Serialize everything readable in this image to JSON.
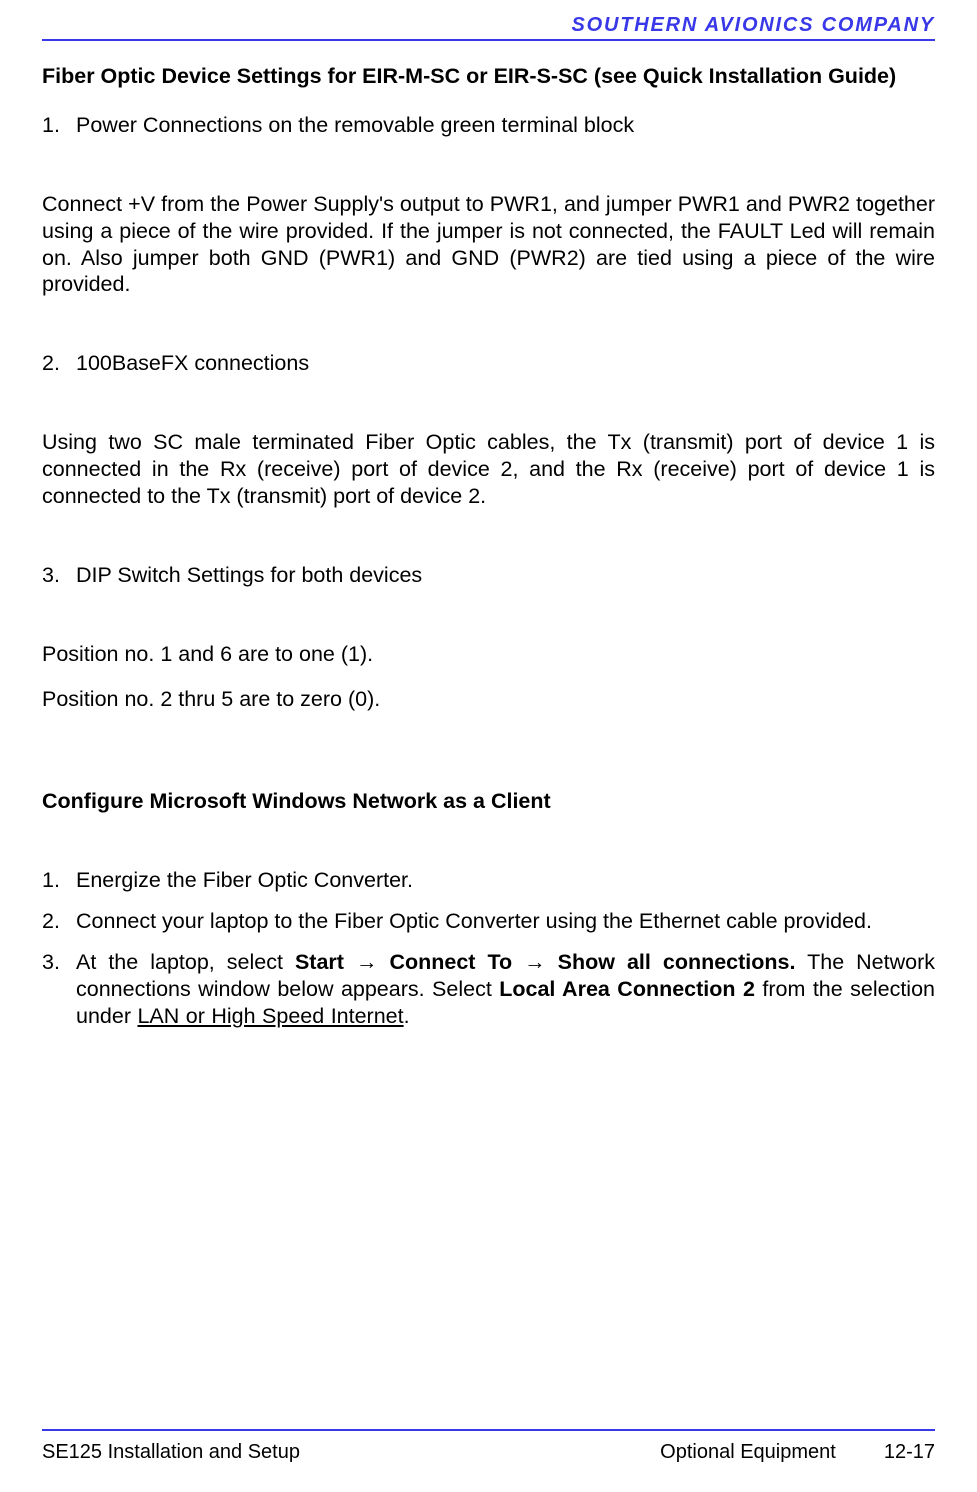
{
  "header": {
    "company": "SOUTHERN AVIONICS COMPANY"
  },
  "section1": {
    "heading": "Fiber Optic Device Settings for EIR-M-SC or EIR-S-SC (see Quick Installation Guide)",
    "items": [
      {
        "num": "1.",
        "text": "Power Connections on the removable green terminal block"
      }
    ],
    "para1": "Connect +V from the Power Supply's output to PWR1, and jumper PWR1 and PWR2 together using a piece of the wire provided.  If the jumper is not connected, the FAULT Led will remain on.  Also jumper both GND (PWR1) and GND (PWR2) are tied using a piece of the wire provided.",
    "items2": [
      {
        "num": "2.",
        "text": "100BaseFX connections"
      }
    ],
    "para2": "Using two SC male terminated Fiber Optic cables, the Tx (transmit) port of device 1 is connected in the Rx (receive) port of device 2, and the Rx (receive) port of device 1 is connected to the Tx (transmit) port of device 2.",
    "items3": [
      {
        "num": "3.",
        "text": "DIP Switch Settings for both devices"
      }
    ],
    "para3": "Position no. 1 and 6 are to one (1).",
    "para4": "Position no. 2 thru 5 are to zero (0)."
  },
  "section2": {
    "heading": "Configure Microsoft Windows Network as a Client",
    "items": [
      {
        "num": "1.",
        "text": "Energize the Fiber Optic Converter."
      },
      {
        "num": "2.",
        "text": "Connect your laptop to the Fiber Optic Converter using the Ethernet cable provided."
      }
    ],
    "item3": {
      "num": "3.",
      "pre": "At the laptop, select ",
      "bold1": "Start ",
      "arrow1": "→",
      "bold2": " Connect To ",
      "arrow2": "→",
      "bold3": " Show all connections.",
      "mid": "   The Network connections window below appears.  Select ",
      "bold4": "Local Area Connection 2",
      "post1": " from the selection under ",
      "underline": "LAN or High Speed Internet",
      "post2": "."
    }
  },
  "footer": {
    "left": "SE125 Installation and Setup",
    "center": "Optional Equipment",
    "right": "12-17"
  }
}
